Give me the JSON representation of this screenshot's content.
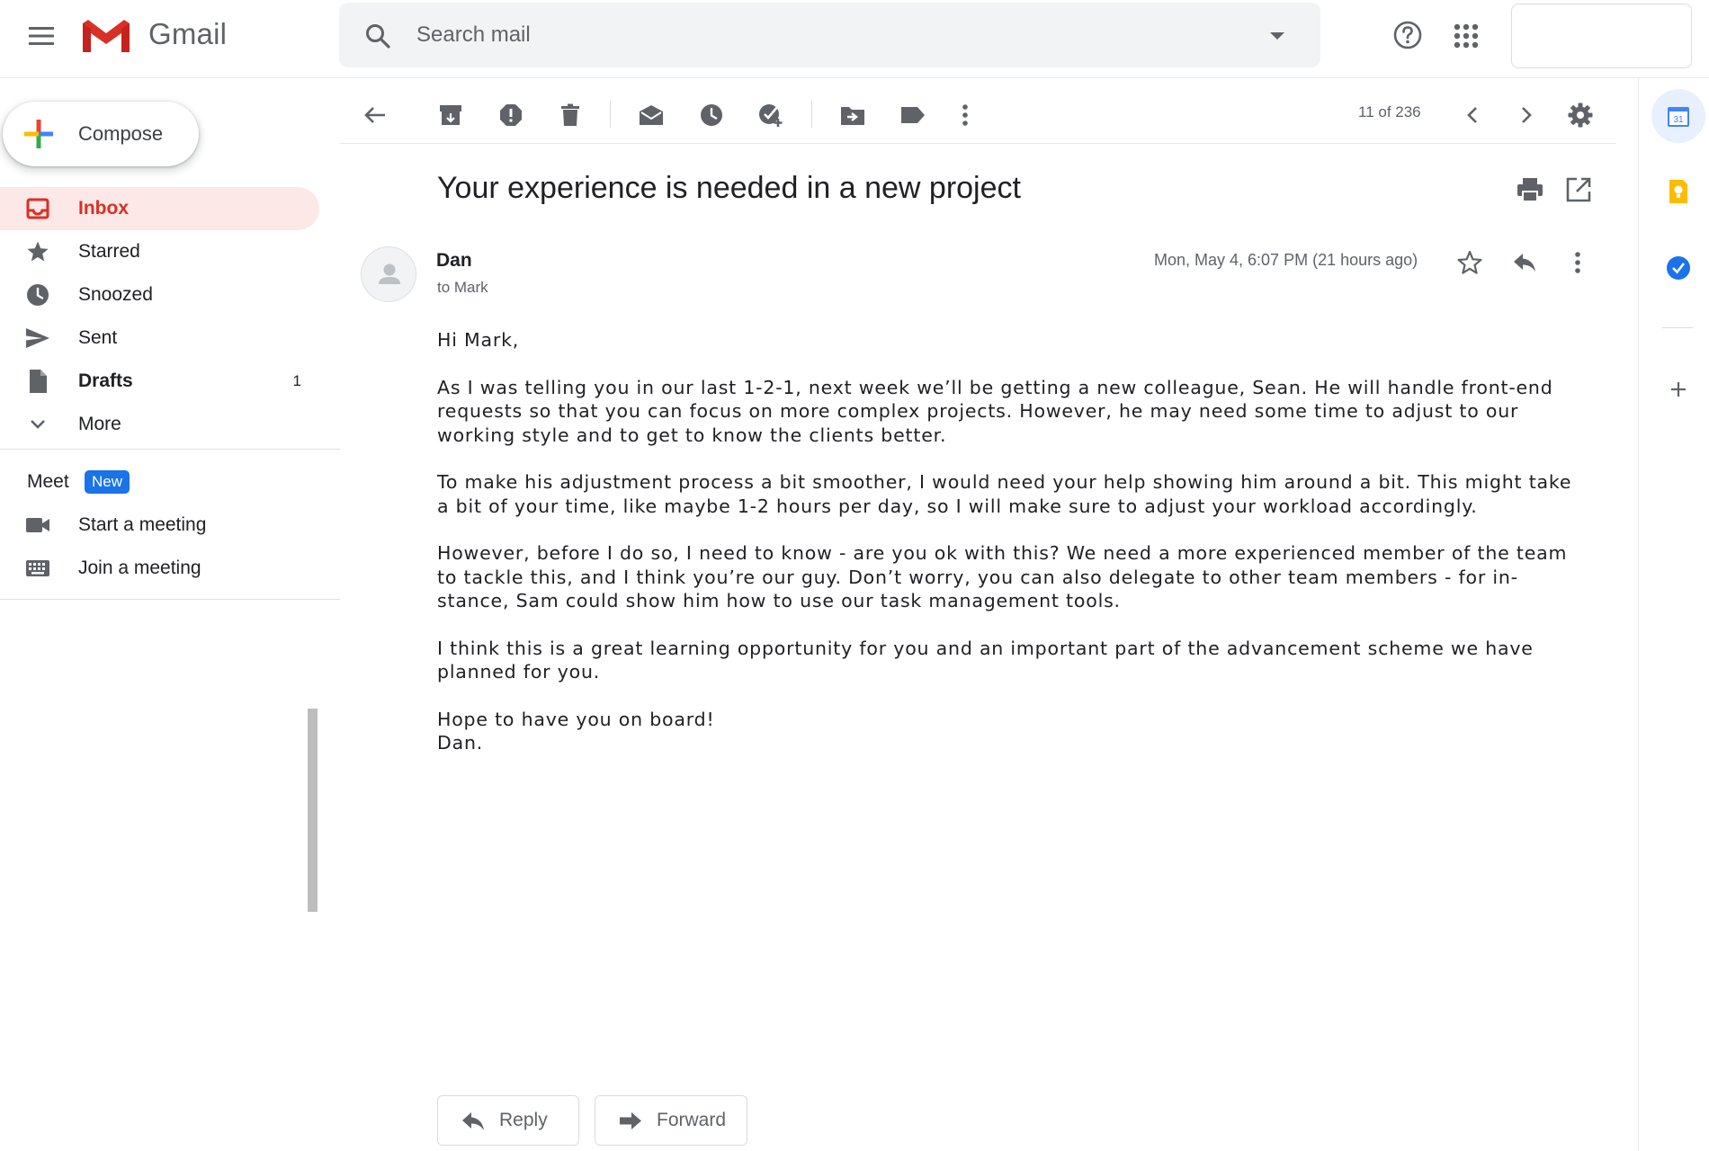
{
  "app": {
    "name": "Gmail"
  },
  "search": {
    "placeholder": "Search mail"
  },
  "compose": {
    "label": "Compose"
  },
  "nav": {
    "items": [
      {
        "label": "Inbox",
        "count": ""
      },
      {
        "label": "Starred",
        "count": ""
      },
      {
        "label": "Snoozed",
        "count": ""
      },
      {
        "label": "Sent",
        "count": ""
      },
      {
        "label": "Drafts",
        "count": "1"
      },
      {
        "label": "More",
        "count": ""
      }
    ]
  },
  "meet": {
    "title": "Meet",
    "badge": "New",
    "items": [
      {
        "label": "Start a meeting"
      },
      {
        "label": "Join a meeting"
      }
    ]
  },
  "toolbar": {
    "pager": "11 of 236"
  },
  "message": {
    "subject": "Your experience is needed in a new project",
    "sender": "Dan",
    "to": "to Mark",
    "date": "Mon, May 4, 6:07 PM (21 hours ago)",
    "body": [
      [
        "Hi Mark,"
      ],
      [
        "As I was telling you in our last 1-2-1, next week we’ll be getting a new colleague, Sean. He will handle front-end",
        "requests so that you can focus on more complex projects. However, he may need some time to adjust to our",
        "working style and to get to know the clients better."
      ],
      [
        "To make his adjustment process a bit smoother, I would need your help showing him around a bit. This might take",
        "a bit of your time, like maybe 1-2 hours per day, so I will make sure to adjust your workload accordingly."
      ],
      [
        "However, before I do so, I need to know - are you ok with this? We need a more experienced member of the team",
        "to tackle this, and I think you’re our guy. Don’t worry, you can also delegate to other team members - for in-",
        "stance, Sam could show him how to use our task management tools."
      ],
      [
        "I think this is a great learning opportunity for you and an important part of the advancement scheme we have",
        "planned for you."
      ],
      [
        "Hope to have you on board!",
        "Dan."
      ]
    ]
  },
  "actions": {
    "reply": "Reply",
    "forward": "Forward"
  },
  "sidepanel": {
    "calendar_day": "31"
  },
  "colors": {
    "accent_red": "#d93025",
    "inbox_bg": "#fce8e6",
    "badge_blue": "#1a73e8",
    "icon_gray": "#5f6368"
  },
  "icons": [
    "menu-icon",
    "gmail-logo",
    "search-icon",
    "help-icon",
    "apps-icon",
    "back-icon",
    "archive-icon",
    "report-spam-icon",
    "delete-icon",
    "mark-unread-icon",
    "snooze-icon",
    "add-to-tasks-icon",
    "move-to-icon",
    "label-icon",
    "more-vert-icon",
    "chevron-left-icon",
    "chevron-right-icon",
    "settings-icon",
    "print-icon",
    "open-new-window-icon",
    "star-icon",
    "reply-icon",
    "forward-icon",
    "inbox-icon",
    "clock-icon",
    "send-icon",
    "draft-icon",
    "chevron-down-icon",
    "videocam-icon",
    "keyboard-icon",
    "calendar-icon",
    "keep-icon",
    "tasks-icon",
    "plus-icon"
  ]
}
